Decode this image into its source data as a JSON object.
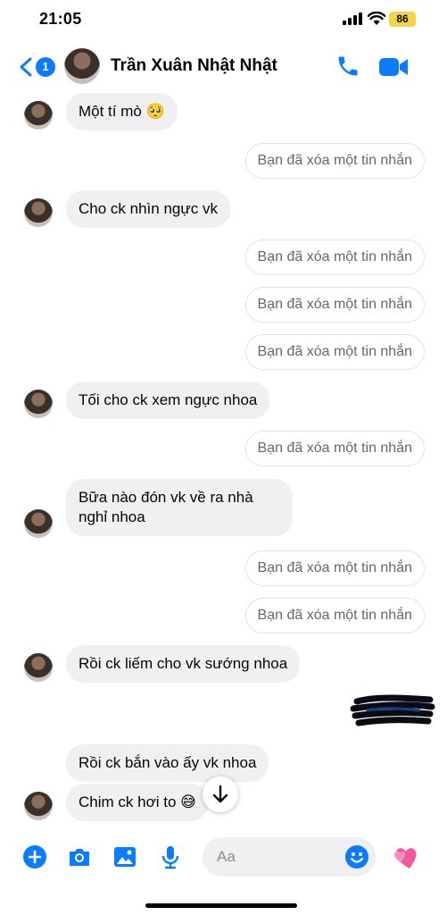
{
  "status_bar": {
    "time": "21:05",
    "battery": "86"
  },
  "header": {
    "back_badge": "1",
    "contact_name": "Trần Xuân Nhật Nhật",
    "icons": {
      "back": "chevron-left-icon",
      "call": "phone-icon",
      "video": "video-camera-icon"
    }
  },
  "messages": [
    {
      "type": "incoming",
      "text": "Một tí mò 🥺"
    },
    {
      "type": "deleted",
      "text": "Bạn đã xóa một tin nhắn"
    },
    {
      "type": "incoming",
      "text": "Cho ck nhìn ngực vk"
    },
    {
      "type": "deleted",
      "text": "Bạn đã xóa một tin nhắn"
    },
    {
      "type": "deleted",
      "text": "Bạn đã xóa một tin nhắn"
    },
    {
      "type": "deleted",
      "text": "Bạn đã xóa một tin nhắn"
    },
    {
      "type": "incoming",
      "text": "Tối cho ck xem ngực nhoa"
    },
    {
      "type": "deleted",
      "text": "Bạn đã xóa một tin nhắn"
    },
    {
      "type": "incoming",
      "line1": "Bữa nào đón vk về ra nhà",
      "line2": "nghỉ nhoa"
    },
    {
      "type": "deleted",
      "text": "Bạn đã xóa một tin nhắn"
    },
    {
      "type": "deleted",
      "text": "Bạn đã xóa một tin nhắn"
    },
    {
      "type": "incoming",
      "text": "Rồi ck liếm cho vk sướng nhoa"
    },
    {
      "type": "incoming",
      "text": "Rồi ck bắn vào ấy vk nhoa"
    },
    {
      "type": "incoming",
      "text": "Chim ck hơi to 😅"
    }
  ],
  "composer": {
    "placeholder": "Aa",
    "icons": [
      "plus-icon",
      "camera-icon",
      "image-icon",
      "microphone-icon",
      "emoji-icon",
      "heart-icon"
    ]
  },
  "colors": {
    "accent": "#0a7cff",
    "incoming_bubble": "#f0f0f2",
    "deleted_text": "#65676b"
  }
}
